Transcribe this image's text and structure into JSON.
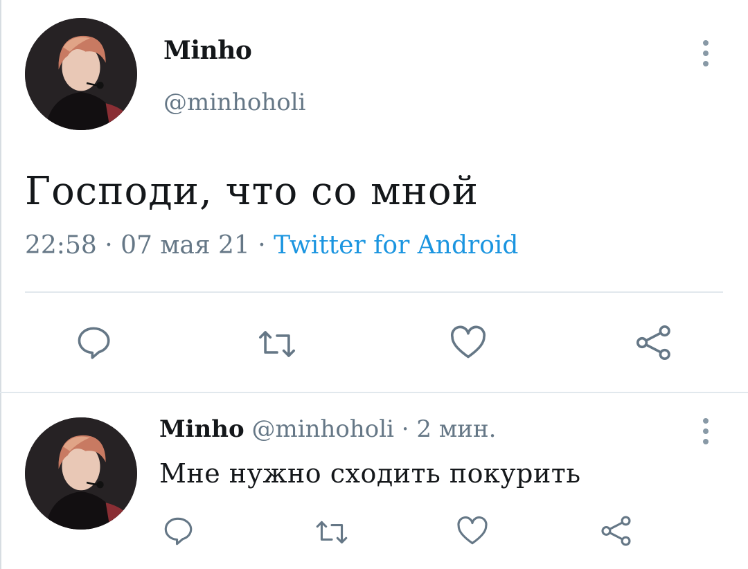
{
  "main_tweet": {
    "display_name": "Minho",
    "handle": "@minhoholi",
    "text": "Господи, что со мной",
    "time": "22:58",
    "separator": "·",
    "date": "07 мая 21",
    "source": "Twitter for Android"
  },
  "reply_tweet": {
    "display_name": "Minho",
    "handle": "@minhoholi",
    "separator": "·",
    "time_ago": "2 мин.",
    "text": "Мне нужно сходить покурить"
  },
  "icons": {
    "more": "more-vertical-icon",
    "reply": "reply-bubble-icon",
    "retweet": "retweet-icon",
    "like": "heart-icon",
    "share": "share-icon"
  },
  "colors": {
    "text": "#14171a",
    "secondary": "#657786",
    "link": "#1b95e0",
    "divider": "#e1e8ed",
    "icon": "#657786"
  }
}
